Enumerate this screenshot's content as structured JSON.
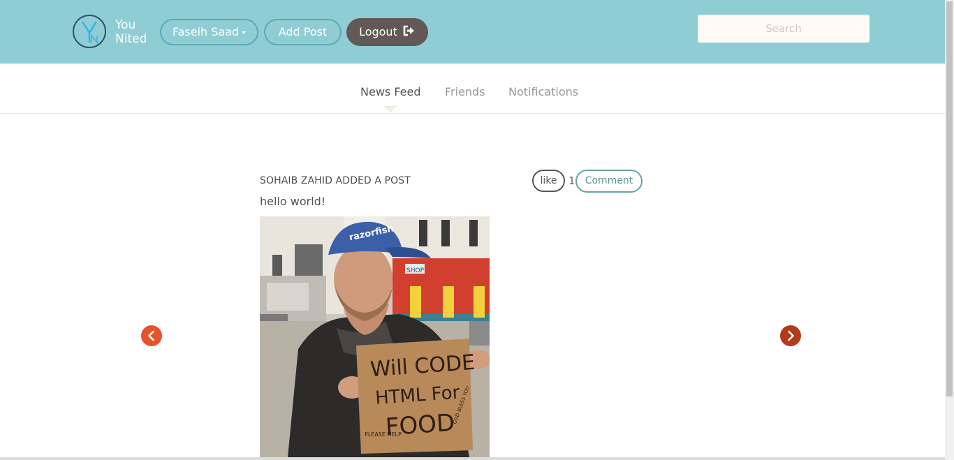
{
  "header": {
    "logo_line1": "You",
    "logo_line2": "Nited",
    "user_label": "Faseih Saad",
    "add_post_label": "Add Post",
    "logout_label": "Logout",
    "search_placeholder": "Search"
  },
  "tabs": [
    {
      "label": "News Feed",
      "active": true
    },
    {
      "label": "Friends",
      "active": false
    },
    {
      "label": "Notifications",
      "active": false
    }
  ],
  "post": {
    "author_line": "SOHAIB ZAHID ADDED A POST",
    "text": "hello world!",
    "like_label": "like",
    "like_count": "1",
    "comment_label": "Comment",
    "image_sign_text": "Will CODE HTML For FOOD",
    "image_sign_small": "PLEASE HELP",
    "image_sign_blessing": "GOD BLESS YOU",
    "image_cap_text": "razorfish",
    "image_storefront_text": "SHOP"
  },
  "colors": {
    "header_bg": "#8ecdd4",
    "logout_bg": "#625956",
    "arrow_left": "#e5532c",
    "arrow_right": "#b53a1c"
  },
  "icons": {
    "logout": "sign-out-icon",
    "prev": "chevron-left-icon",
    "next": "chevron-right-icon"
  }
}
